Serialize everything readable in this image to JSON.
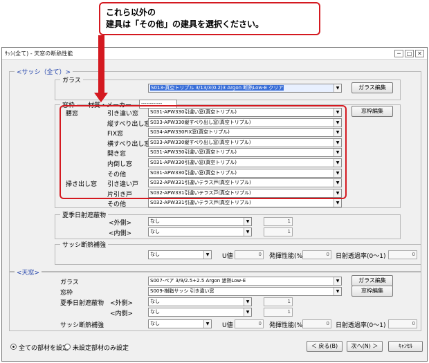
{
  "callout": {
    "line1": "これら以外の",
    "line2": "建具は「その他」の建具を選択ください。"
  },
  "window": {
    "title": "ｻｯｼ(全て) - 天窓の断熱性能",
    "minimize": "─",
    "maximize": "□",
    "close": "✕"
  },
  "sash_group": {
    "label": "<サッシ（全て）>"
  },
  "glass": {
    "label": "ガラス",
    "value": "S013-真空トリプル 3/13/3(0.2)3 Argon 断熱Low-E クリア",
    "edit_button": "ガラス編集"
  },
  "frame": {
    "label": "窓枠",
    "material_label": "材質・メーカー",
    "material_value": "------------",
    "edit_button": "窓枠編集"
  },
  "windows": {
    "waist_label": "腰窓",
    "sweep_label": "掃き出し窓",
    "rows": [
      {
        "label": "引き違い窓",
        "value": "S031-APW330引違い窓(真空トリプル)"
      },
      {
        "label": "縦すべり出し窓",
        "value": "S033-APW330縦すべり出し窓(真空トリプル)"
      },
      {
        "label": "FIX窓",
        "value": "S034-APW330FIX窓(真空トリプル)"
      },
      {
        "label": "横すべり出し窓",
        "value": "S033-APW330縦すべり出し窓(真空トリプル)"
      },
      {
        "label": "開き窓",
        "value": "S031-APW330引違い窓(真空トリプル)"
      },
      {
        "label": "内倒し窓",
        "value": "S031-APW330引違い窓(真空トリプル)"
      },
      {
        "label": "その他",
        "value": "S031-APW330引違い窓(真空トリプル)"
      },
      {
        "label": "引き違い戸",
        "value": "S032-APW331引違いテラス戸(真空トリプル)"
      },
      {
        "label": "片引き戸",
        "value": "S032-APW331引違いテラス戸(真空トリプル)"
      },
      {
        "label": "その他",
        "value": "S032-APW331引違いテラス戸(真空トリプル)"
      }
    ]
  },
  "shading": {
    "label": "夏季日射遮蔽物",
    "outer_label": "<外側>",
    "inner_label": "<内側>",
    "outer_value": "なし",
    "inner_value": "なし",
    "outer_num": "1",
    "inner_num": "1"
  },
  "sash_insulation": {
    "label": "サッシ断熱補強",
    "value": "なし",
    "u_label": "U値",
    "u_value": "0",
    "heat_label": "発揮性能(%)",
    "heat_value": "0",
    "solar_label": "日射透過率(0〜1)",
    "solar_value": "0"
  },
  "skylight": {
    "group_label": "<天窓>",
    "glass_label": "ガラス",
    "glass_value": "S007-ペア 3/9/2.5+2.5 Argon 遮熱Low-E",
    "glass_button": "ガラス編集",
    "frame_label": "窓枠",
    "frame_value": "S009-樹脂サッシ 引き違い窓",
    "frame_button": "窓枠編集",
    "shading_label": "夏季日射遮蔽物",
    "outer_label": "<外側>",
    "inner_label": "<内側>",
    "outer_value": "なし",
    "inner_value": "なし",
    "outer_num": "1",
    "inner_num": "1",
    "insulation_label": "サッシ断熱補強",
    "insulation_value": "なし",
    "u_label": "U値",
    "u_value": "0",
    "heat_label": "発揮性能(%)",
    "heat_value": "0",
    "solar_label": "日射透過率(0〜1)",
    "solar_value": "0"
  },
  "footer": {
    "radio_all": "全ての部材を設定",
    "radio_unset": "未設定部材のみ設定",
    "back": "＜ 戻る(B)",
    "next": "次へ(N) ＞",
    "cancel": "ｷｬﾝｾﾙ"
  },
  "colors": {
    "accent_red": "#d41920",
    "label_blue": "#1a3ca8"
  }
}
